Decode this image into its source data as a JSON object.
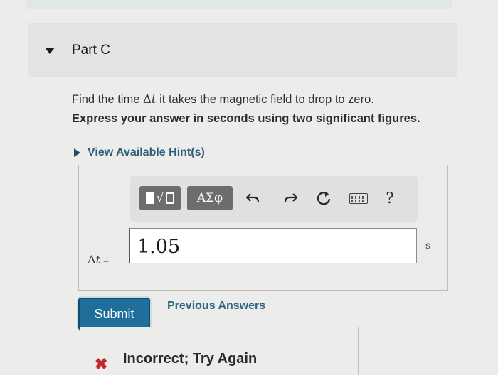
{
  "part": {
    "title": "Part C",
    "caret_icon": "caret-down-icon"
  },
  "question": {
    "prefix": "Find the time ",
    "symbol": "Δ",
    "variable": "t",
    "suffix": " it takes the magnetic field to drop to zero."
  },
  "instruction": "Express your answer in seconds using two significant figures.",
  "hint": {
    "label": "View Available Hint(s)",
    "icon": "caret-right-icon"
  },
  "toolbar": {
    "templates_icon": "templates-icon",
    "greek_label": "ΑΣφ",
    "undo_icon": "undo-icon",
    "redo_icon": "redo-icon",
    "reset_icon": "reset-icon",
    "keyboard_icon": "keyboard-icon",
    "help_label": "?"
  },
  "answer": {
    "variable_symbol": "Δ",
    "variable_letter": "t",
    "equals": "=",
    "value": "1.05",
    "unit": "s"
  },
  "actions": {
    "submit_label": "Submit",
    "previous_answers_label": "Previous Answers"
  },
  "feedback": {
    "icon": "x-icon",
    "mark": "✖",
    "text": "Incorrect; Try Again",
    "color": "#c1272d"
  },
  "colors": {
    "accent": "#1f6f9a",
    "link": "#2f6787",
    "error": "#c1272d"
  }
}
